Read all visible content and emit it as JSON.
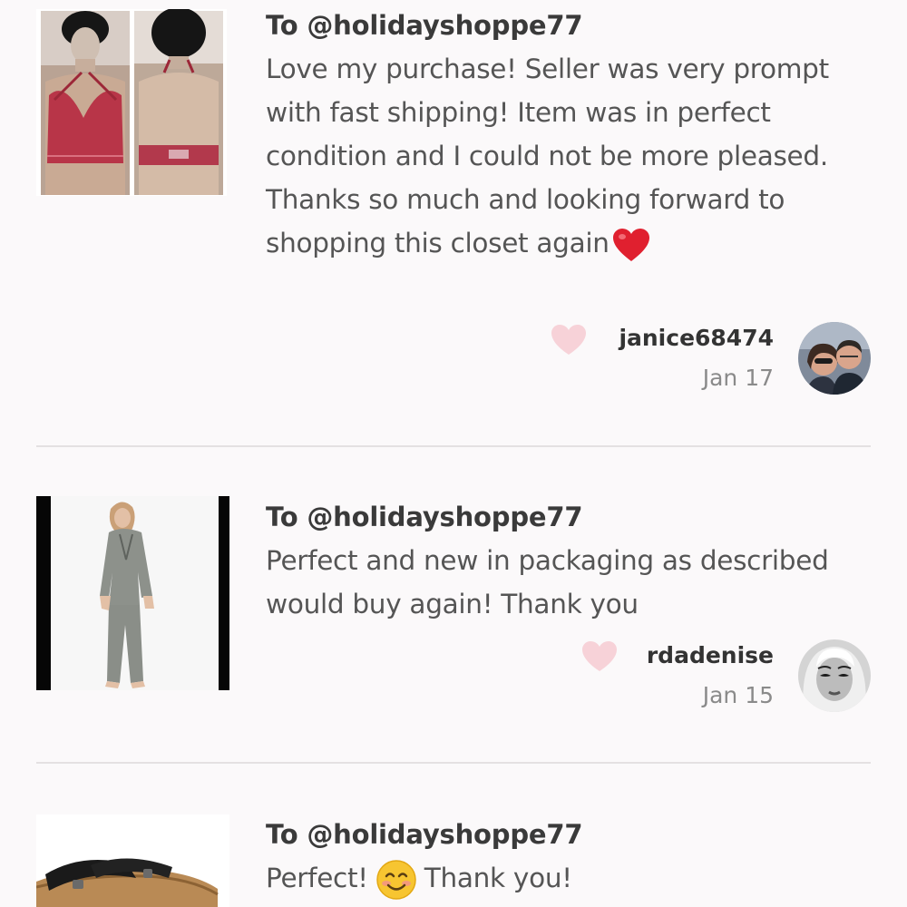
{
  "reviews": [
    {
      "recipient": "To @holidayshoppe77",
      "text": "Love my purchase! Seller was very prompt with fast shipping! Item was in perfect condition and I could not be more pleased. Thanks so much and looking forward to shopping this closet again",
      "emoji": "red-heart",
      "username": "janice68474",
      "date": "Jan 17",
      "liked": false
    },
    {
      "recipient": "To @holidayshoppe77",
      "text": "Perfect and new in packaging as described would buy again! Thank you",
      "username": "rdadenise",
      "date": "Jan 15",
      "liked": false
    },
    {
      "recipient": "To @holidayshoppe77",
      "text_before": "Perfect!",
      "emoji": "smiling-face",
      "text_after": "Thank you!"
    }
  ],
  "colors": {
    "background": "#fbf9fa",
    "like_heart": "#f7d2d8",
    "divider": "#e4e1e2",
    "username": "#333333",
    "date": "#8a8a8a"
  }
}
